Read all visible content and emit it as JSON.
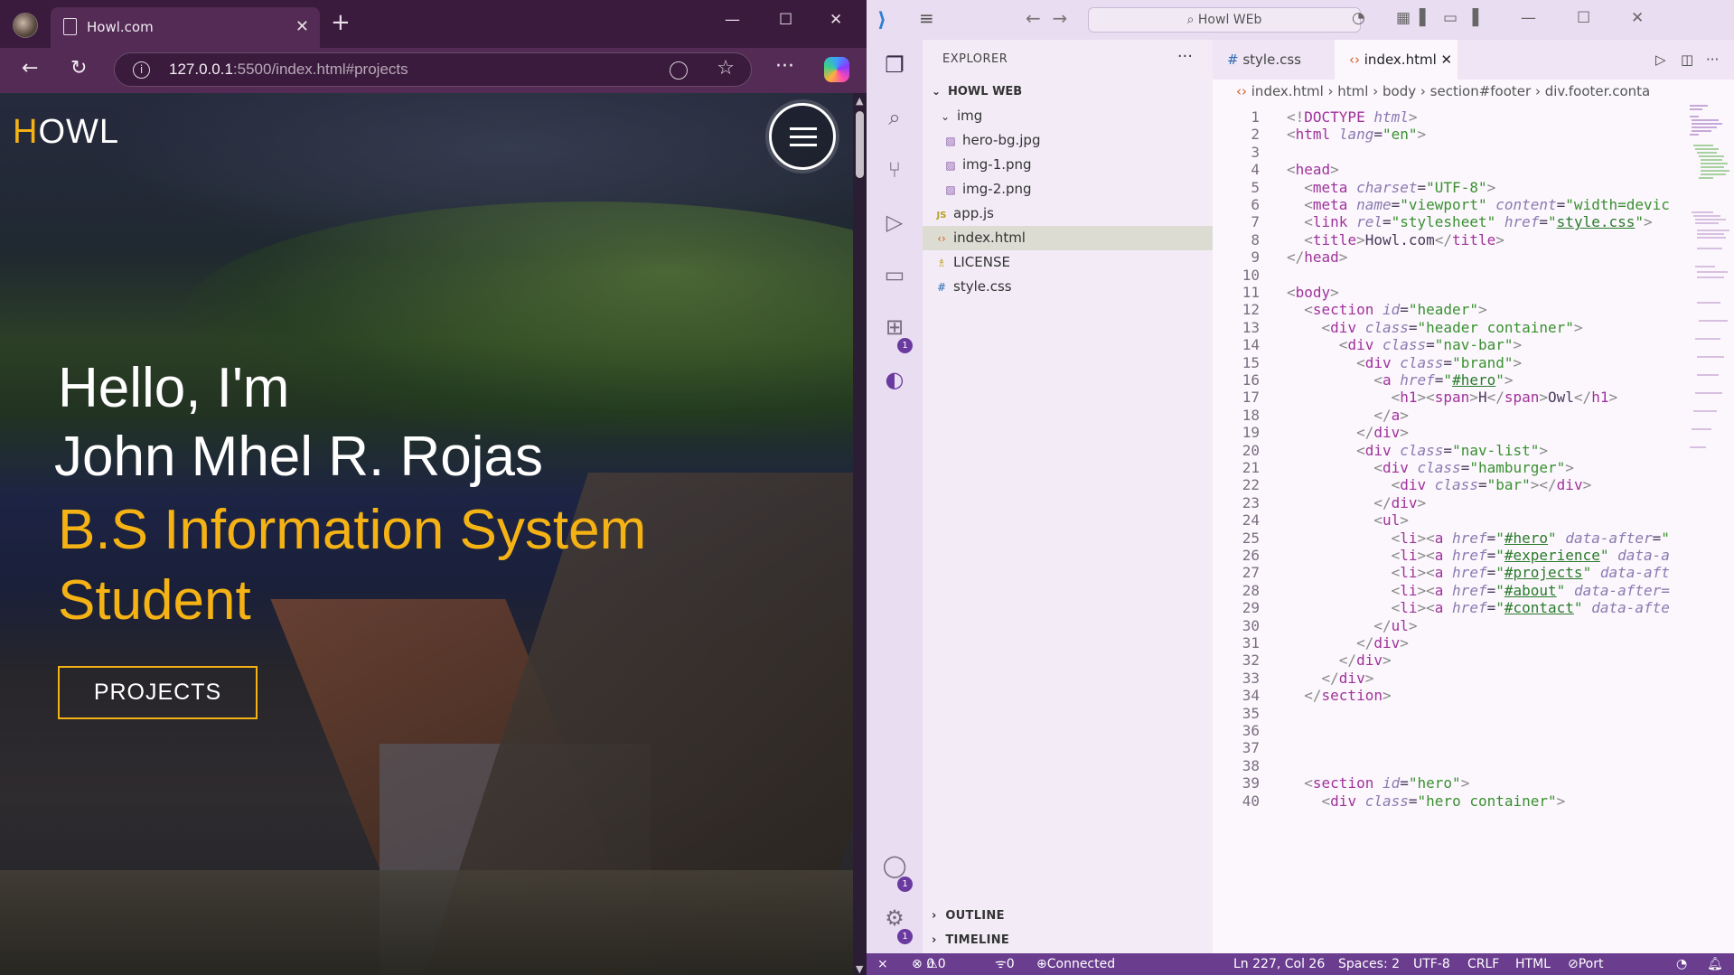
{
  "browser": {
    "tab_title": "Howl.com",
    "url_host": "127.0.0.1",
    "url_rest": ":5500/index.html#projects",
    "page": {
      "logo_first": "H",
      "logo_rest": "OWL",
      "line1": "Hello, I'm",
      "line2": "John Mhel R. Rojas",
      "line3": "B.S Information System Student",
      "button": "PROJECTS"
    },
    "accent": "#f5b214"
  },
  "vscode": {
    "search": "Howl WEb",
    "explorer_title": "EXPLORER",
    "root": "HOWL WEB",
    "tree": [
      {
        "name": "img",
        "icon": "chevron-down-icon",
        "depth": 1
      },
      {
        "name": "hero-bg.jpg",
        "icon": "image-icon",
        "depth": 2
      },
      {
        "name": "img-1.png",
        "icon": "image-icon",
        "depth": 2
      },
      {
        "name": "img-2.png",
        "icon": "image-icon",
        "depth": 2
      },
      {
        "name": "app.js",
        "icon": "js-icon",
        "depth": 1
      },
      {
        "name": "index.html",
        "icon": "html-icon",
        "depth": 1
      },
      {
        "name": "LICENSE",
        "icon": "license-icon",
        "depth": 1
      },
      {
        "name": "style.css",
        "icon": "css-icon",
        "depth": 1
      }
    ],
    "outline": "OUTLINE",
    "timeline": "TIMELINE",
    "tabs": [
      "style.css",
      "index.html"
    ],
    "breadcrumb": [
      "index.html",
      "html",
      "body",
      "section#footer",
      "div.footer.conta"
    ],
    "status": {
      "problems_errors": "0",
      "problems_warnings": "0",
      "ports": "0",
      "discord": "Connected to Discord",
      "position": "Ln 227, Col 26",
      "spaces": "Spaces: 2",
      "encoding": "UTF-8",
      "eol": "CRLF",
      "language": "HTML",
      "port": "Port : 5500"
    },
    "badges": {
      "extensions": "1",
      "accounts": "1",
      "settings": "1"
    },
    "status_color": "#6a3d8f"
  }
}
